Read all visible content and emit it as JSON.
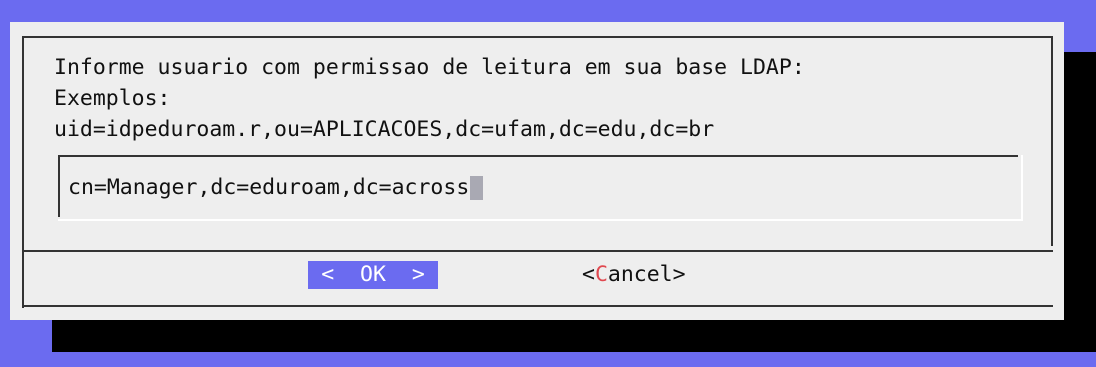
{
  "dialog": {
    "prompt_lines": [
      "Informe usuario com permissao de leitura em sua base LDAP:",
      "Exemplos:",
      "uid=idpeduroam.r,ou=APLICACOES,dc=ufam,dc=edu,dc=br"
    ],
    "input": {
      "value": "cn=Manager,dc=eduroam,dc=across"
    },
    "buttons": {
      "ok_label": "<  OK  >",
      "cancel_open": "<",
      "cancel_hotkey": "C",
      "cancel_rest": "ancel>"
    }
  },
  "colors": {
    "background": "#6b6bf0",
    "dialog": "#eeeeee",
    "shadow": "#000000",
    "button_selected": "#6b6bf0",
    "hotkey": "#e0484f"
  }
}
